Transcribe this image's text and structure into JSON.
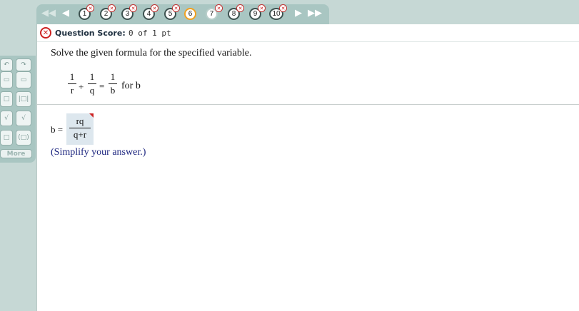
{
  "navigation": {
    "first_icon": "double-left-arrow-icon",
    "prev_icon": "left-arrow-icon",
    "next_icon": "right-arrow-icon",
    "last_icon": "double-right-arrow-icon",
    "questions": [
      {
        "label": "1",
        "status": "incorrect"
      },
      {
        "label": "2",
        "status": "incorrect"
      },
      {
        "label": "3",
        "status": "incorrect"
      },
      {
        "label": "4",
        "status": "incorrect"
      },
      {
        "label": "5",
        "status": "incorrect"
      },
      {
        "label": "6",
        "status": "current"
      },
      {
        "label": "7",
        "status": "incorrect"
      },
      {
        "label": "8",
        "status": "incorrect"
      },
      {
        "label": "9",
        "status": "incorrect"
      },
      {
        "label": "10",
        "status": "incorrect"
      }
    ],
    "incorrect_mark": "✕"
  },
  "score": {
    "label": "Question Score:",
    "value": "0 of 1 pt",
    "status_icon": "incorrect-x-icon"
  },
  "question": {
    "instruction": "Solve the given formula for the specified variable.",
    "term1": {
      "num": "1",
      "den": "r"
    },
    "term2": {
      "num": "1",
      "den": "q"
    },
    "term3": {
      "num": "1",
      "den": "b"
    },
    "plus": "+",
    "equals": "=",
    "suffix": "for b"
  },
  "answer": {
    "label": "b =",
    "num": "rq",
    "den": "q+r",
    "hint": "(Simplify your answer.)"
  },
  "palette": {
    "more_label": "More",
    "tools": [
      "undo-icon",
      "redo-icon",
      "fraction-icon",
      "mixed-number-icon",
      "exponent-icon",
      "absolute-value-icon",
      "sqrt-icon",
      "nth-root-icon",
      "subscript-icon",
      "ordered-pair-icon"
    ]
  },
  "colors": {
    "accent": "#a9c6c2",
    "incorrect": "#cc2222",
    "current": "#f0a020",
    "hint_text": "#1a237e"
  }
}
